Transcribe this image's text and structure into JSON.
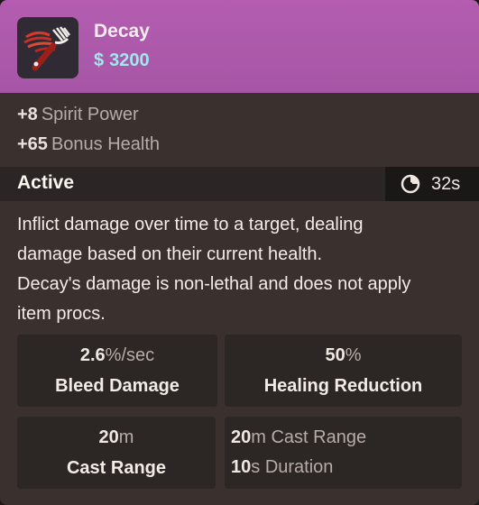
{
  "item": {
    "name": "Decay",
    "cost_symbol": "$",
    "cost": "3200",
    "icon": "decay-scythe-icon"
  },
  "passive_stats": [
    {
      "value": "+8",
      "label": "Spirit Power"
    },
    {
      "value": "+65",
      "label": "Bonus Health"
    }
  ],
  "active": {
    "title": "Active",
    "cooldown": "32s",
    "cooldown_icon": "cooldown-icon",
    "description": [
      "Inflict damage over time to a target, dealing",
      "damage based on their current health.",
      "Decay's damage is non-lethal and does not apply",
      "item procs."
    ],
    "boxes": [
      {
        "value": "2.6",
        "unit": "%/sec",
        "label": "Bleed Damage"
      },
      {
        "value": "50",
        "unit": "%",
        "label": "Healing Reduction"
      },
      {
        "value": "20",
        "unit": "m",
        "label": "Cast Range"
      }
    ],
    "extra_stats": [
      {
        "value": "20",
        "unit": "m",
        "label": "Cast Range"
      },
      {
        "value": "10",
        "unit": "s",
        "label": "Duration"
      }
    ]
  },
  "colors": {
    "header": "#b45db0",
    "cost": "#9ee9ec",
    "panel": "#3a302e"
  }
}
